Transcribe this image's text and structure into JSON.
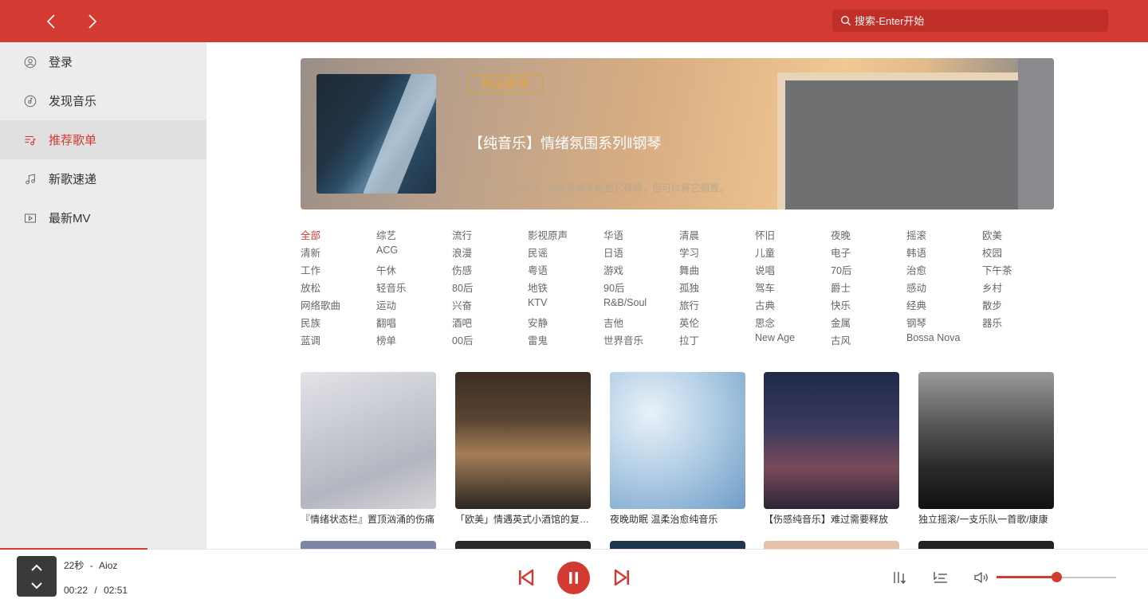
{
  "search": {
    "placeholder": "搜索-Enter开始"
  },
  "sidebar": {
    "items": [
      {
        "label": "登录",
        "icon": "user-icon",
        "active": false
      },
      {
        "label": "发现音乐",
        "icon": "disc-icon",
        "active": false
      },
      {
        "label": "推荐歌单",
        "icon": "playlist-icon",
        "active": true
      },
      {
        "label": "新歌速递",
        "icon": "music-note-icon",
        "active": false
      },
      {
        "label": "最新MV",
        "icon": "video-icon",
        "active": false
      }
    ]
  },
  "banner": {
    "tag": "精品歌单",
    "title": "【纯音乐】情绪氛围系列‖钢琴",
    "description": "孤独是一个你的，谁和谁都不能把它移除，但可以将它搁置。"
  },
  "categories": [
    "全部",
    "综艺",
    "流行",
    "影视原声",
    "华语",
    "清晨",
    "怀旧",
    "夜晚",
    "摇滚",
    "欧美",
    "清新",
    "ACG",
    "浪漫",
    "民谣",
    "日语",
    "学习",
    "儿童",
    "电子",
    "韩语",
    "校园",
    "工作",
    "午休",
    "伤感",
    "粤语",
    "游戏",
    "舞曲",
    "说唱",
    "70后",
    "治愈",
    "下午茶",
    "放松",
    "轻音乐",
    "80后",
    "地铁",
    "90后",
    "孤独",
    "驾车",
    "爵士",
    "感动",
    "乡村",
    "网络歌曲",
    "运动",
    "兴奋",
    "KTV",
    "R&B/Soul",
    "旅行",
    "古典",
    "快乐",
    "经典",
    "散步",
    "民族",
    "翻唱",
    "酒吧",
    "安静",
    "吉他",
    "英伦",
    "思念",
    "金属",
    "钢琴",
    "器乐",
    "蓝调",
    "榜单",
    "00后",
    "雷鬼",
    "世界音乐",
    "拉丁",
    "New Age",
    "古风",
    "Bossa Nova"
  ],
  "playlists": [
    {
      "name": "『情绪状态栏』置顶汹涌的伤痛"
    },
    {
      "name": "「欧美」情遇英式小酒馆的复古时光"
    },
    {
      "name": "夜晚助眠 温柔治愈纯音乐"
    },
    {
      "name": "【伤感纯音乐】难过需要释放"
    },
    {
      "name": "独立摇滚/一支乐队一首歌/康康"
    }
  ],
  "player": {
    "song": "22秒",
    "separator": "-",
    "artist": "Aioz",
    "current_time": "00:22",
    "time_separator": "/",
    "duration": "02:51",
    "progress": 0.1287,
    "volume": 0.5
  },
  "colors": {
    "accent": "#d33a31",
    "sidebar_bg": "#ececec"
  }
}
